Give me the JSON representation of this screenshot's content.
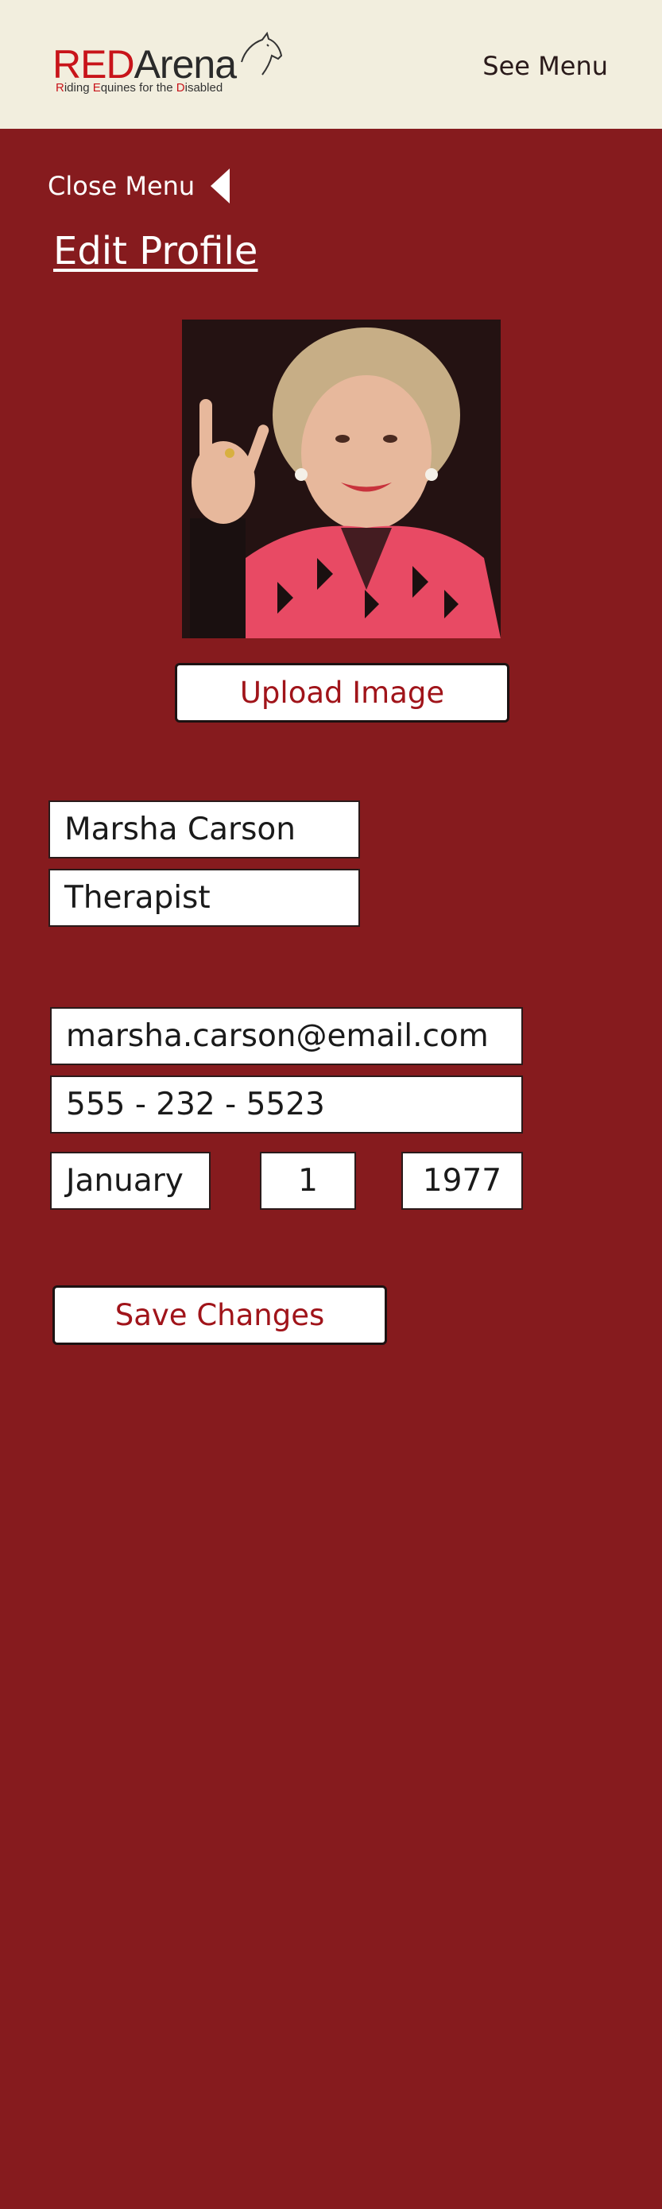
{
  "header": {
    "logo_red": "RED",
    "logo_dark": "Arena",
    "logo_tagline_parts": [
      "R",
      "iding ",
      "E",
      "quines for the ",
      "D",
      "isabled"
    ],
    "see_menu_label": "See Menu"
  },
  "sidebar": {
    "close_menu_label": "Close Menu"
  },
  "main": {
    "title": "Edit Profile",
    "upload_label": "Upload Image",
    "fields": {
      "name": "Marsha Carson",
      "role": "Therapist",
      "email": "marsha.carson@email.com",
      "phone": "555 - 232 - 5523",
      "birth_month": "January",
      "birth_day": "1",
      "birth_year": "1977"
    },
    "save_label": "Save Changes"
  },
  "colors": {
    "background": "#861b1e",
    "header_bg": "#f2eede",
    "brand_red": "#c8141a",
    "button_text": "#a0141a"
  }
}
